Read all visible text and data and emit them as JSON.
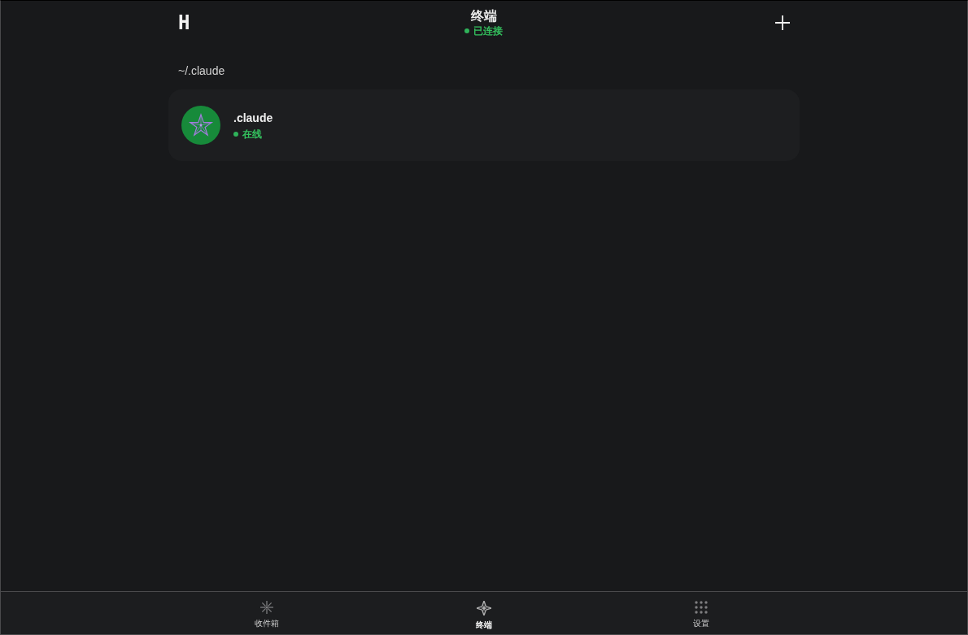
{
  "header": {
    "logo": "H",
    "title": "终端",
    "status": {
      "label": "已连接",
      "connected": true
    }
  },
  "sections": [
    {
      "heading": "~/.claude",
      "items": [
        {
          "name": ".claude",
          "status": "在线",
          "online": true
        }
      ]
    }
  ],
  "bottom_nav": [
    {
      "label": "收件箱",
      "selected": false
    },
    {
      "label": "终端",
      "selected": true
    },
    {
      "label": "设置",
      "selected": false
    }
  ]
}
